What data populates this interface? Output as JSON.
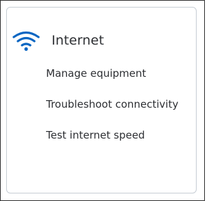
{
  "card": {
    "icon": "wifi-icon",
    "title": "Internet",
    "links": [
      {
        "label": "Manage equipment"
      },
      {
        "label": "Troubleshoot connectivity"
      },
      {
        "label": "Test internet speed"
      }
    ]
  },
  "colors": {
    "accent": "#0a66c2",
    "text": "#2d2f33",
    "card_border": "#c6cdd4"
  }
}
